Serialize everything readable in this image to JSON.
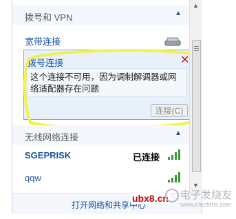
{
  "sections": {
    "dialup_vpn": {
      "title": "拨号和 VPN"
    },
    "wireless": {
      "title": "无线网络连接"
    }
  },
  "broadband": {
    "label": "宽带连接"
  },
  "dialup": {
    "label": "拨号连接",
    "message": "这个连接不可用，因为调制解调器或网络适配器存在问题",
    "connect_button": "连接(C)"
  },
  "wifi": [
    {
      "name": "SGEPRISK",
      "status": "已连接"
    },
    {
      "name": "qqw",
      "status": ""
    }
  ],
  "footer": {
    "link": "打开网络和共享中心"
  },
  "watermark": {
    "site": "ubx8.cn",
    "brand": "电子发烧友",
    "url": "www.elecfans.com"
  },
  "colors": {
    "link_blue": "#1c53a8",
    "highlight_yellow": "#f2f24a",
    "close_red": "#c8102e"
  }
}
